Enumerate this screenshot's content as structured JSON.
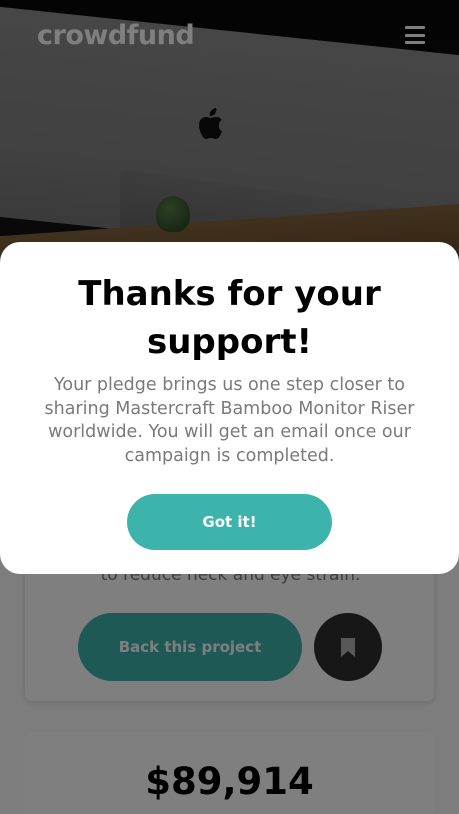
{
  "header": {
    "logo_text": "crowdfund"
  },
  "project": {
    "description_tail": "to reduce neck and eye strain.",
    "back_button_label": "Back this project"
  },
  "stats": {
    "amount_backed": "$89,914"
  },
  "modal": {
    "title": "Thanks for your support!",
    "message": "Your pledge brings us one step closer to sharing Mastercraft Bamboo Monitor Riser worldwide. You will get an email once our campaign is completed.",
    "button_label": "Got it!"
  },
  "colors": {
    "accent": "#3cb3ab",
    "dark": "#2f2f2f",
    "text_gray": "#7a7a7a"
  },
  "icons": {
    "menu": "hamburger-menu-icon",
    "bookmark": "bookmark-icon"
  }
}
